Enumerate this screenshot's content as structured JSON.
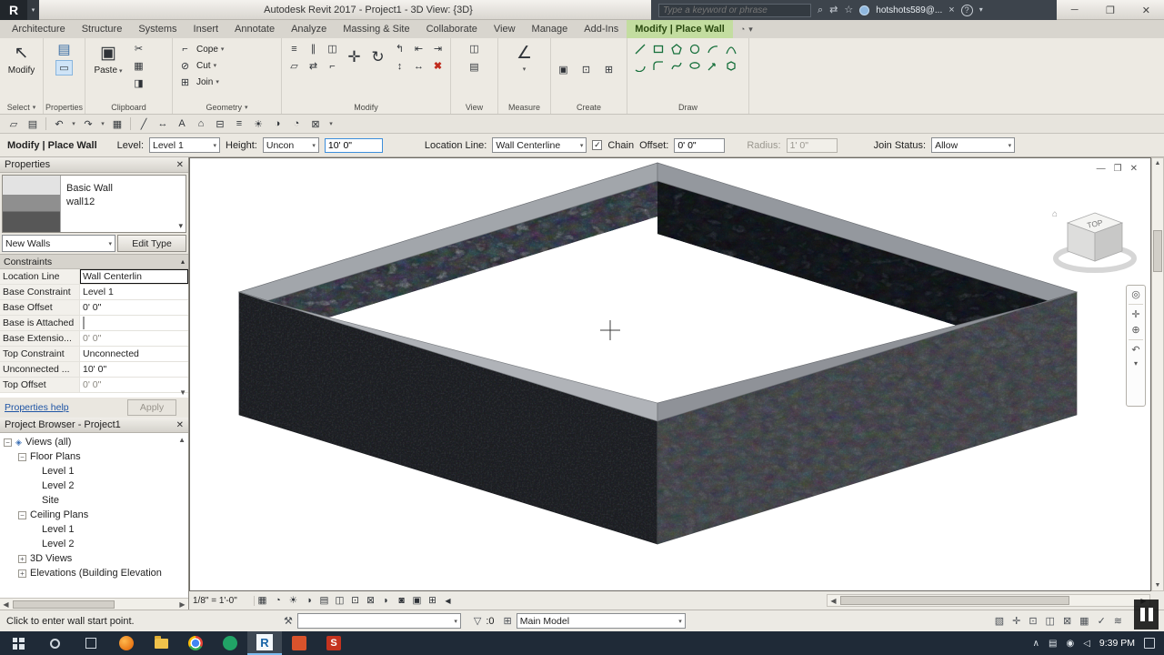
{
  "titlebar": {
    "logo_letter": "R",
    "title": "Autodesk Revit 2017 - Project1 - 3D View: {3D}",
    "search_placeholder": "Type a keyword or phrase",
    "account": "hotshots589@..."
  },
  "ribbon": {
    "tabs": [
      {
        "label": "Architecture"
      },
      {
        "label": "Structure"
      },
      {
        "label": "Systems"
      },
      {
        "label": "Insert"
      },
      {
        "label": "Annotate"
      },
      {
        "label": "Analyze"
      },
      {
        "label": "Massing & Site"
      },
      {
        "label": "Collaborate"
      },
      {
        "label": "View"
      },
      {
        "label": "Manage"
      },
      {
        "label": "Add-Ins"
      },
      {
        "label": "Modify | Place Wall"
      }
    ],
    "select_panel": {
      "modify_label": "Modify",
      "caption": "Select"
    },
    "properties_panel": {
      "caption": "Properties"
    },
    "clipboard_panel": {
      "paste_label": "Paste",
      "caption": "Clipboard"
    },
    "geometry_panel": {
      "cope": "Cope",
      "cut": "Cut",
      "join": "Join",
      "caption": "Geometry"
    },
    "modify_panel": {
      "caption": "Modify"
    },
    "view_panel": {
      "caption": "View"
    },
    "measure_panel": {
      "caption": "Measure"
    },
    "create_panel": {
      "caption": "Create"
    },
    "draw_panel": {
      "caption": "Draw"
    }
  },
  "options_bar": {
    "context_label": "Modify | Place Wall",
    "level_label": "Level:",
    "level_value": "Level 1",
    "height_label": "Height:",
    "height_mode": "Uncon",
    "height_value": "10' 0\"",
    "location_label": "Location Line:",
    "location_value": "Wall Centerline",
    "chain_label": "Chain",
    "offset_label": "Offset:",
    "offset_value": "0' 0\"",
    "radius_label": "Radius:",
    "radius_value": "1' 0\"",
    "join_label": "Join Status:",
    "join_value": "Allow"
  },
  "properties_palette": {
    "title": "Properties",
    "type_name": "Basic Wall",
    "type_variant": "wall12",
    "selector_value": "New Walls",
    "edit_type_label": "Edit Type",
    "section": "Constraints",
    "rows": [
      {
        "label": "Location Line",
        "value": "Wall Centerlin"
      },
      {
        "label": "Base Constraint",
        "value": "Level 1"
      },
      {
        "label": "Base Offset",
        "value": "0' 0\""
      },
      {
        "label": "Base is Attached",
        "value": ""
      },
      {
        "label": "Base Extensio...",
        "value": "0' 0\""
      },
      {
        "label": "Top Constraint",
        "value": "Unconnected"
      },
      {
        "label": "Unconnected ...",
        "value": "10' 0\""
      },
      {
        "label": "Top Offset",
        "value": "0' 0\""
      }
    ],
    "help_link": "Properties help",
    "apply_label": "Apply"
  },
  "project_browser": {
    "title": "Project Browser - Project1",
    "items": [
      {
        "label": "Views (all)"
      },
      {
        "label": "Floor Plans"
      },
      {
        "label": "Level 1"
      },
      {
        "label": "Level 2"
      },
      {
        "label": "Site"
      },
      {
        "label": "Ceiling Plans"
      },
      {
        "label": "Level 1"
      },
      {
        "label": "Level 2"
      },
      {
        "label": "3D Views"
      },
      {
        "label": "Elevations (Building Elevation"
      }
    ]
  },
  "viewport": {
    "scale_label": "1/8\" = 1'-0\"",
    "viewcube_top_label": "TOP"
  },
  "status_bar": {
    "hint": "Click to enter wall start point.",
    "selection_count": ":0",
    "main_model_label": "Main Model"
  },
  "taskbar": {
    "time": "9:39 PM"
  },
  "scene": {
    "wall_dark": "#36393f",
    "wall_medium": "#7b7e84",
    "wall_texture_light": "#cdd1d8",
    "wall_texture_dark": "#5d636c",
    "floor": "#ffffff"
  }
}
